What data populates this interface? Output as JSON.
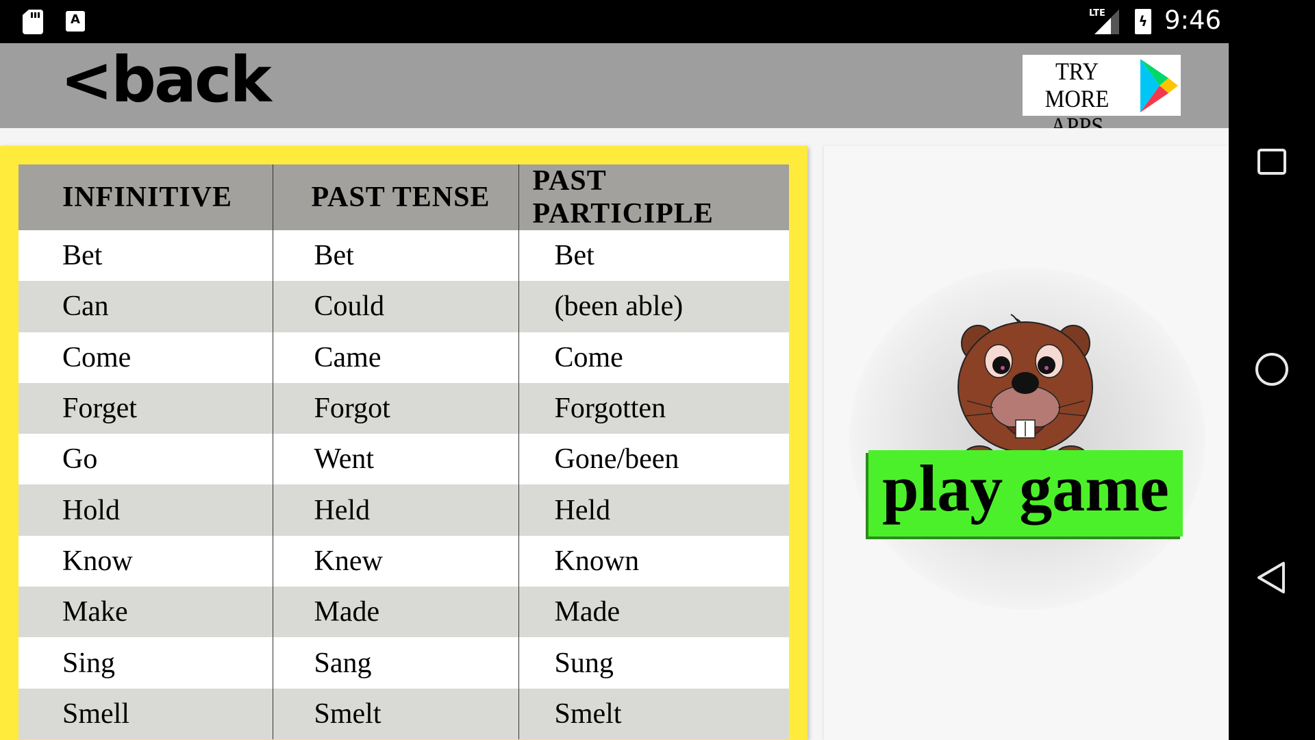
{
  "status_bar": {
    "left_icons": [
      "sd-card-icon",
      "accessibility-a-icon"
    ],
    "network": "LTE",
    "time": "9:46"
  },
  "app_bar": {
    "back_label": "<back",
    "more_apps_label": "TRY MORE APPS",
    "more_apps_line1": "TRY",
    "more_apps_line2": "MORE APPS"
  },
  "verb_table": {
    "headers": [
      "INFINITIVE",
      "PAST TENSE",
      "PAST PARTICIPLE"
    ],
    "rows": [
      [
        "Bet",
        "Bet",
        "Bet"
      ],
      [
        "Can",
        "Could",
        "(been able)"
      ],
      [
        "Come",
        "Came",
        "Come"
      ],
      [
        "Forget",
        "Forgot",
        "Forgotten"
      ],
      [
        "Go",
        "Went",
        "Gone/been"
      ],
      [
        "Hold",
        "Held",
        "Held"
      ],
      [
        "Know",
        "Knew",
        "Known"
      ],
      [
        "Make",
        "Made",
        "Made"
      ],
      [
        "Sing",
        "Sang",
        "Sung"
      ],
      [
        "Smell",
        "Smelt",
        "Smelt"
      ]
    ]
  },
  "game_panel": {
    "mascot": "beaver-mascot",
    "play_label": "play game"
  },
  "nav_bar": {
    "buttons": [
      "recents",
      "home",
      "back"
    ]
  },
  "colors": {
    "app_bar": "#9e9e9e",
    "table_panel": "#ffeb3b",
    "table_header": "#a3a19d",
    "row_alt": "#d9d9d5",
    "play_button": "#4cf02a"
  }
}
